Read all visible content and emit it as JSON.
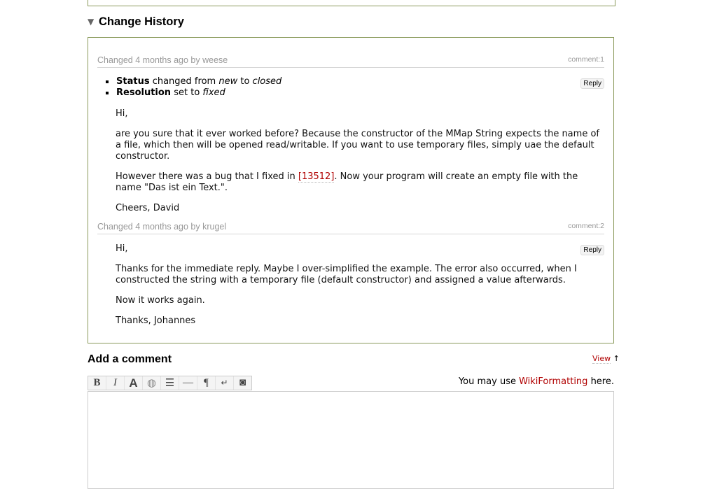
{
  "change_history": {
    "title": "Change History",
    "changes": [
      {
        "header": "Changed 4 months ago by weese",
        "comment_number": "comment:1",
        "reply_label": "Reply",
        "fields": [
          {
            "name": "Status",
            "text_1": "changed from",
            "old": "new",
            "text_2": "to",
            "new": "closed"
          },
          {
            "name": "Resolution",
            "text_1": "set to",
            "new": "fixed"
          }
        ],
        "paragraphs": [
          "Hi,",
          "are you sure that it ever worked before? Because the constructor of the MMap String expects the name of a file, which then will be opened read/writable. If you want to use temporary files, simply uae the default constructor.",
          {
            "before": "However there was a bug that I fixed in ",
            "link": "[13512]",
            "after": ". Now your program will create an empty file with the name \"Das ist ein Text.\"."
          },
          "Cheers, David"
        ]
      },
      {
        "header": "Changed 4 months ago by krugel",
        "comment_number": "comment:2",
        "reply_label": "Reply",
        "paragraphs": [
          "Hi,",
          "Thanks for the immediate reply. Maybe I over-simplified the example. The error also occurred, when I constructed the string with a temporary file (default constructor) and assigned a value afterwards.",
          "Now it works again.",
          "Thanks, Johannes"
        ]
      }
    ]
  },
  "add_comment": {
    "title": "Add a comment",
    "view_label": "View",
    "view_arrow": "↑",
    "hint_before": "You may use ",
    "hint_link": "WikiFormatting",
    "hint_after": " here.",
    "toolbar": [
      {
        "name": "bold-button",
        "glyph": "B"
      },
      {
        "name": "italic-button",
        "glyph": "I"
      },
      {
        "name": "heading-button",
        "glyph": "A"
      },
      {
        "name": "link-button",
        "glyph": "◍"
      },
      {
        "name": "code-block-button",
        "glyph": "☰"
      },
      {
        "name": "horizontal-rule-button",
        "glyph": "—"
      },
      {
        "name": "paragraph-button",
        "glyph": "¶"
      },
      {
        "name": "line-break-button",
        "glyph": "↵"
      },
      {
        "name": "image-button",
        "glyph": "◙"
      }
    ]
  },
  "colors": {
    "link": "#b00000",
    "box_border": "#8a9a5b",
    "meta_text": "#999999"
  }
}
